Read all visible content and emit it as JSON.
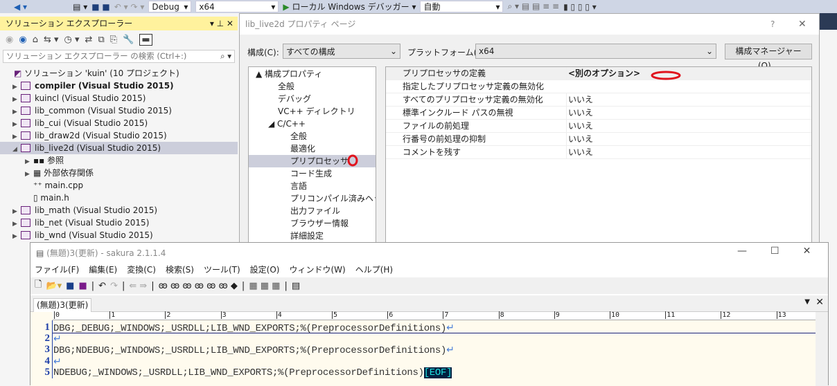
{
  "vs_toolbar": {
    "config": "Debug",
    "platform": "x64",
    "run": "ローカル Windows デバッガー",
    "mode": "自動"
  },
  "solution_explorer": {
    "title": "ソリューション エクスプローラー",
    "search_placeholder": "ソリューション エクスプローラー の検索 (Ctrl+:)",
    "solution": "ソリューション 'kuin' (10 プロジェクト)",
    "items": [
      {
        "label": "compiler (Visual Studio 2015)",
        "bold": true
      },
      {
        "label": "kuincl (Visual Studio 2015)"
      },
      {
        "label": "lib_common (Visual Studio 2015)"
      },
      {
        "label": "lib_cui (Visual Studio 2015)"
      },
      {
        "label": "lib_draw2d (Visual Studio 2015)"
      },
      {
        "label": "lib_live2d (Visual Studio 2015)",
        "selected": true
      },
      {
        "label": "参照",
        "child": true
      },
      {
        "label": "外部依存関係",
        "child": true
      },
      {
        "label": "main.cpp",
        "child": true
      },
      {
        "label": "main.h",
        "child": true
      },
      {
        "label": "lib_math (Visual Studio 2015)"
      },
      {
        "label": "lib_net (Visual Studio 2015)"
      },
      {
        "label": "lib_wnd (Visual Studio 2015)"
      }
    ]
  },
  "dialog": {
    "title": "lib_live2d プロパティ ページ",
    "help": "?",
    "close": "✕",
    "config_label": "構成(C):",
    "config_value": "すべての構成",
    "platform_label": "プラットフォーム(P):",
    "platform_value": "x64",
    "manager_button": "構成マネージャー(O)...",
    "tree": [
      {
        "label": "▲ 構成プロパティ",
        "level": 0
      },
      {
        "label": "全般",
        "level": 1
      },
      {
        "label": "デバッグ",
        "level": 1
      },
      {
        "label": "VC++ ディレクトリ",
        "level": 1
      },
      {
        "label": "◢ C/C++",
        "level": 1
      },
      {
        "label": "全般",
        "level": 2
      },
      {
        "label": "最適化",
        "level": 2
      },
      {
        "label": "プリプロセッサ",
        "level": 2,
        "selected": true
      },
      {
        "label": "コード生成",
        "level": 2
      },
      {
        "label": "言語",
        "level": 2
      },
      {
        "label": "プリコンパイル済みヘッダー",
        "level": 2
      },
      {
        "label": "出力ファイル",
        "level": 2
      },
      {
        "label": "ブラウザー情報",
        "level": 2
      },
      {
        "label": "詳細設定",
        "level": 2
      }
    ],
    "properties": [
      {
        "key": "プリプロセッサの定義",
        "value": "<別のオプション>",
        "bold": true
      },
      {
        "key": "指定したプリプロセッサ定義の無効化",
        "value": ""
      },
      {
        "key": "すべてのプリプロセッサ定義の無効化",
        "value": "いいえ"
      },
      {
        "key": "標準インクルード パスの無視",
        "value": "いいえ"
      },
      {
        "key": "ファイルの前処理",
        "value": "いいえ"
      },
      {
        "key": "行番号の前処理の抑制",
        "value": "いいえ"
      },
      {
        "key": "コメントを残す",
        "value": "いいえ"
      }
    ]
  },
  "sakura": {
    "title": "(無題)3(更新) - sakura 2.1.1.4",
    "menu": [
      "ファイル(F)",
      "編集(E)",
      "変換(C)",
      "検索(S)",
      "ツール(T)",
      "設定(O)",
      "ウィンドウ(W)",
      "ヘルプ(H)"
    ],
    "tab": "(無題)3(更新)",
    "ruler": [
      "0",
      "1",
      "2",
      "3",
      "4",
      "5",
      "6",
      "7",
      "8",
      "9",
      "10",
      "11",
      "12",
      "13"
    ],
    "lines": [
      {
        "num": "1",
        "text": "DBG;_DEBUG;_WINDOWS;_USRDLL;LIB_WND_EXPORTS;%(PreprocessorDefinitions)",
        "end": "↵"
      },
      {
        "num": "2",
        "text": "",
        "end": "↵"
      },
      {
        "num": "3",
        "text": "DBG;NDEBUG;_WINDOWS;_USRDLL;LIB_WND_EXPORTS;%(PreprocessorDefinitions)",
        "end": "↵"
      },
      {
        "num": "4",
        "text": "",
        "end": "↵"
      },
      {
        "num": "5",
        "text": "NDEBUG;_WINDOWS;_USRDLL;LIB_WND_EXPORTS;%(PreprocessorDefinitions)",
        "end": "[EOF]"
      }
    ]
  },
  "colors": {
    "annotation": "#e0141e",
    "se_title": "#fff29d"
  }
}
